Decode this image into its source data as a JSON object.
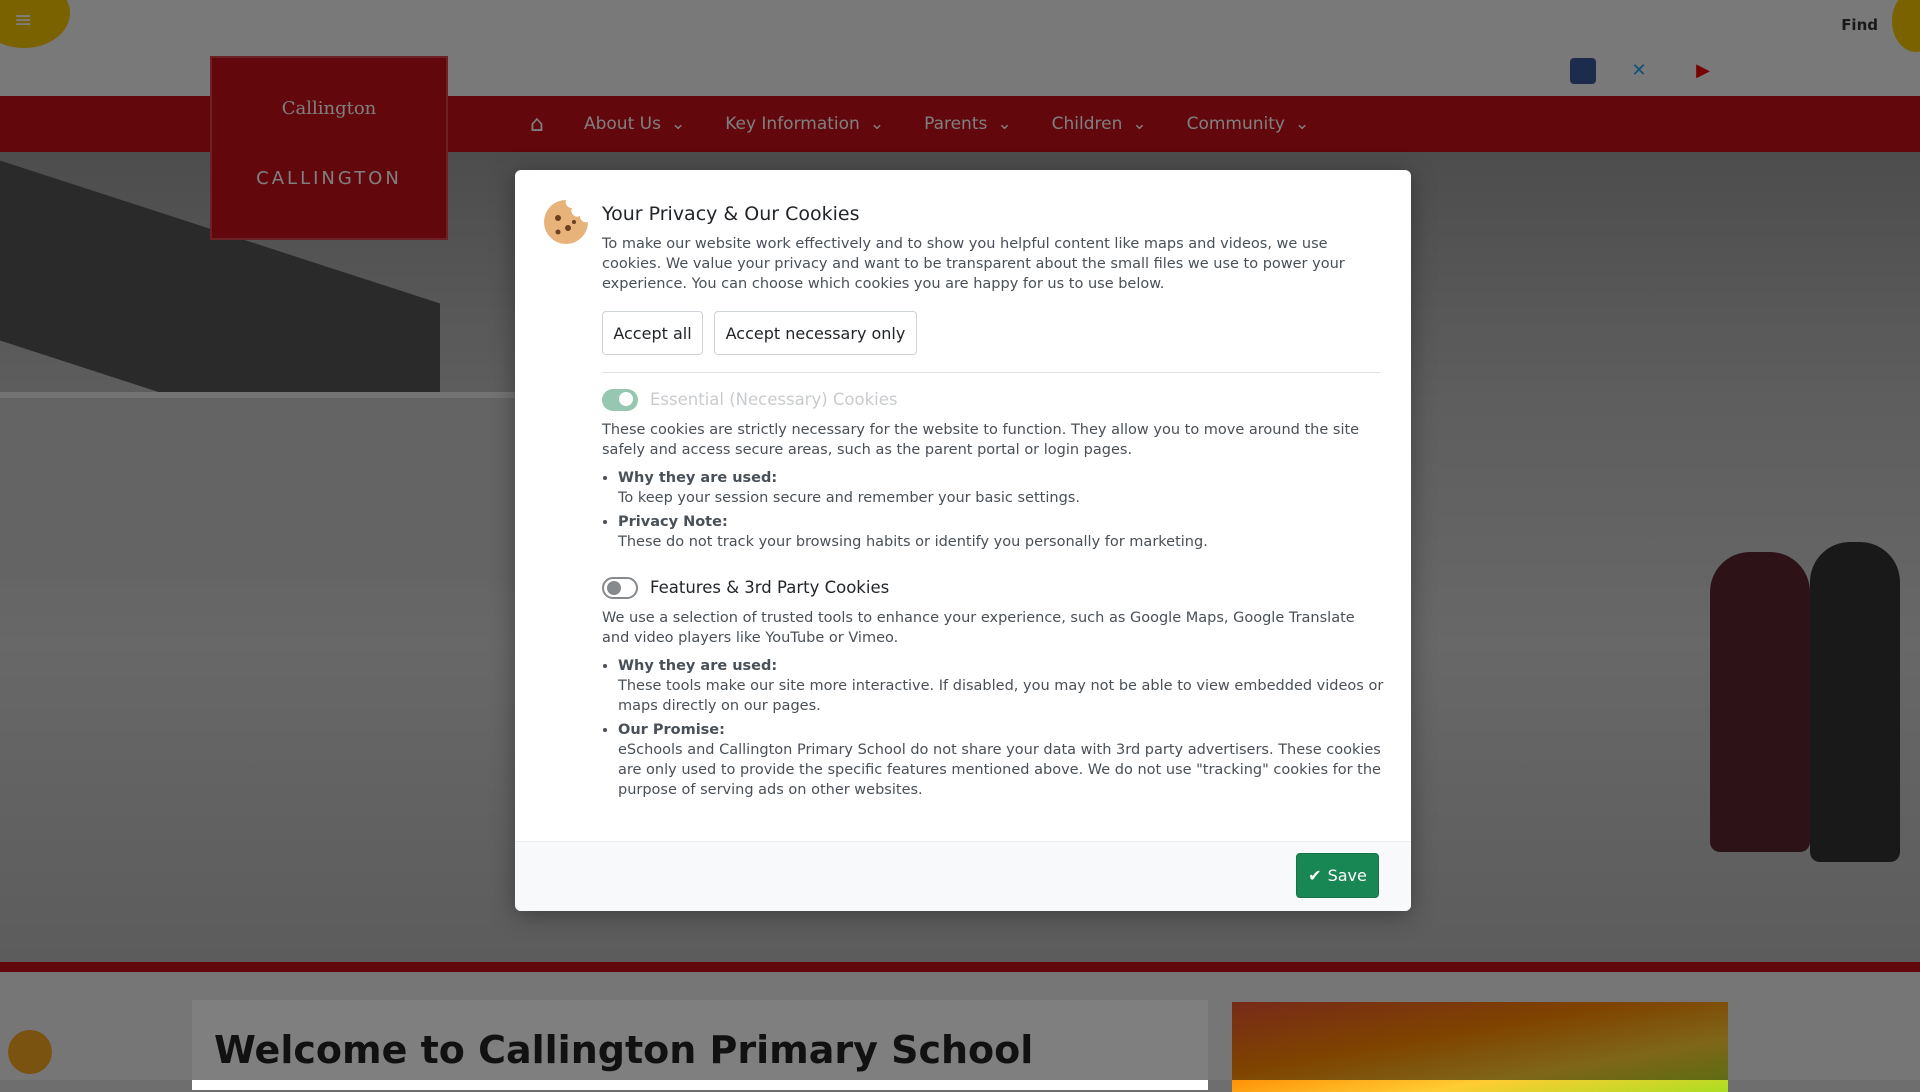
{
  "background": {
    "top_right_text": "Find",
    "nav": {
      "home_icon": "home-icon",
      "items": [
        {
          "label": "About Us"
        },
        {
          "label": "Key Information"
        },
        {
          "label": "Parents"
        },
        {
          "label": "Children"
        },
        {
          "label": "Community"
        }
      ]
    },
    "logo": {
      "line1": "Callington",
      "line2": "CALLINGTON"
    },
    "welcome_title": "Welcome to Callington Primary School"
  },
  "modal": {
    "title": "Your Privacy & Our Cookies",
    "intro": "To make our website work effectively and to show you helpful content like maps and videos, we use cookies. We value your privacy and want to be transparent about the small files we use to power your experience. You can choose which cookies you are happy for us to use below.",
    "accept_all_label": "Accept all",
    "accept_necessary_label": "Accept necessary only",
    "essential": {
      "title": "Essential (Necessary) Cookies",
      "enabled": true,
      "description": "These cookies are strictly necessary for the website to function. They allow you to move around the site safely and access secure areas, such as the parent portal or login pages.",
      "bullets": [
        {
          "heading": "Why they are used:",
          "text": "To keep your session secure and remember your basic settings."
        },
        {
          "heading": "Privacy Note:",
          "text": "These do not track your browsing habits or identify you personally for marketing."
        }
      ]
    },
    "features": {
      "title": "Features & 3rd Party Cookies",
      "enabled": false,
      "description": "We use a selection of trusted tools to enhance your experience, such as Google Maps, Google Translate and video players like YouTube or Vimeo.",
      "bullets": [
        {
          "heading": "Why they are used:",
          "text": "These tools make our site more interactive. If disabled, you may not be able to view embedded videos or maps directly on our pages."
        },
        {
          "heading": "Our Promise:",
          "text": "eSchools and Callington Primary School do not share your data with 3rd party advertisers. These cookies are only used to provide the specific features mentioned above. We do not use \"tracking\" cookies for the purpose of serving ads on other websites."
        }
      ]
    },
    "save_label": "Save"
  },
  "colors": {
    "brand_red": "#c4101a",
    "save_green": "#198754",
    "accent_yellow": "#f5c400"
  }
}
